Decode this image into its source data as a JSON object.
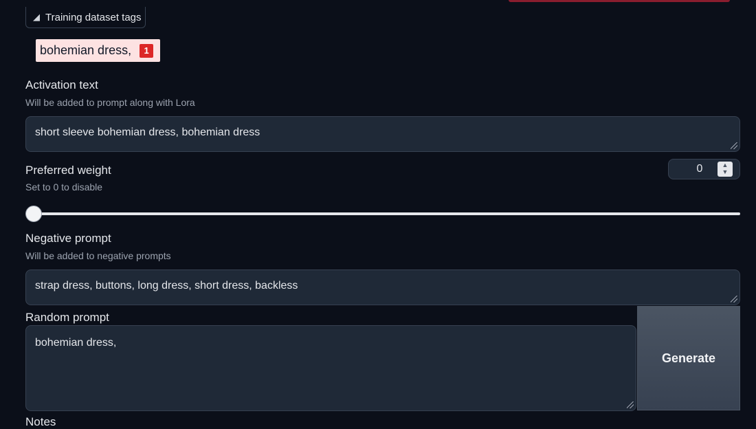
{
  "tags_tab": {
    "label": "Training dataset tags",
    "icon": "tag-icon"
  },
  "tag_chip": {
    "text": "bohemian dress,",
    "count": "1"
  },
  "activation": {
    "label": "Activation text",
    "description": "Will be added to prompt along with Lora",
    "value": "short sleeve bohemian dress, bohemian dress"
  },
  "weight": {
    "label": "Preferred weight",
    "description": "Set to 0 to disable",
    "value": "0"
  },
  "negative": {
    "label": "Negative prompt",
    "description": "Will be added to negative prompts",
    "value": "strap dress, buttons, long dress, short dress, backless"
  },
  "random": {
    "label": "Random prompt",
    "value": "bohemian dress,",
    "generate_label": "Generate"
  },
  "next_label": "Notes",
  "colors": {
    "background": "#0b0f19",
    "input": "#1f2937",
    "badge": "#dc2626",
    "chip": "#fde2e2"
  }
}
